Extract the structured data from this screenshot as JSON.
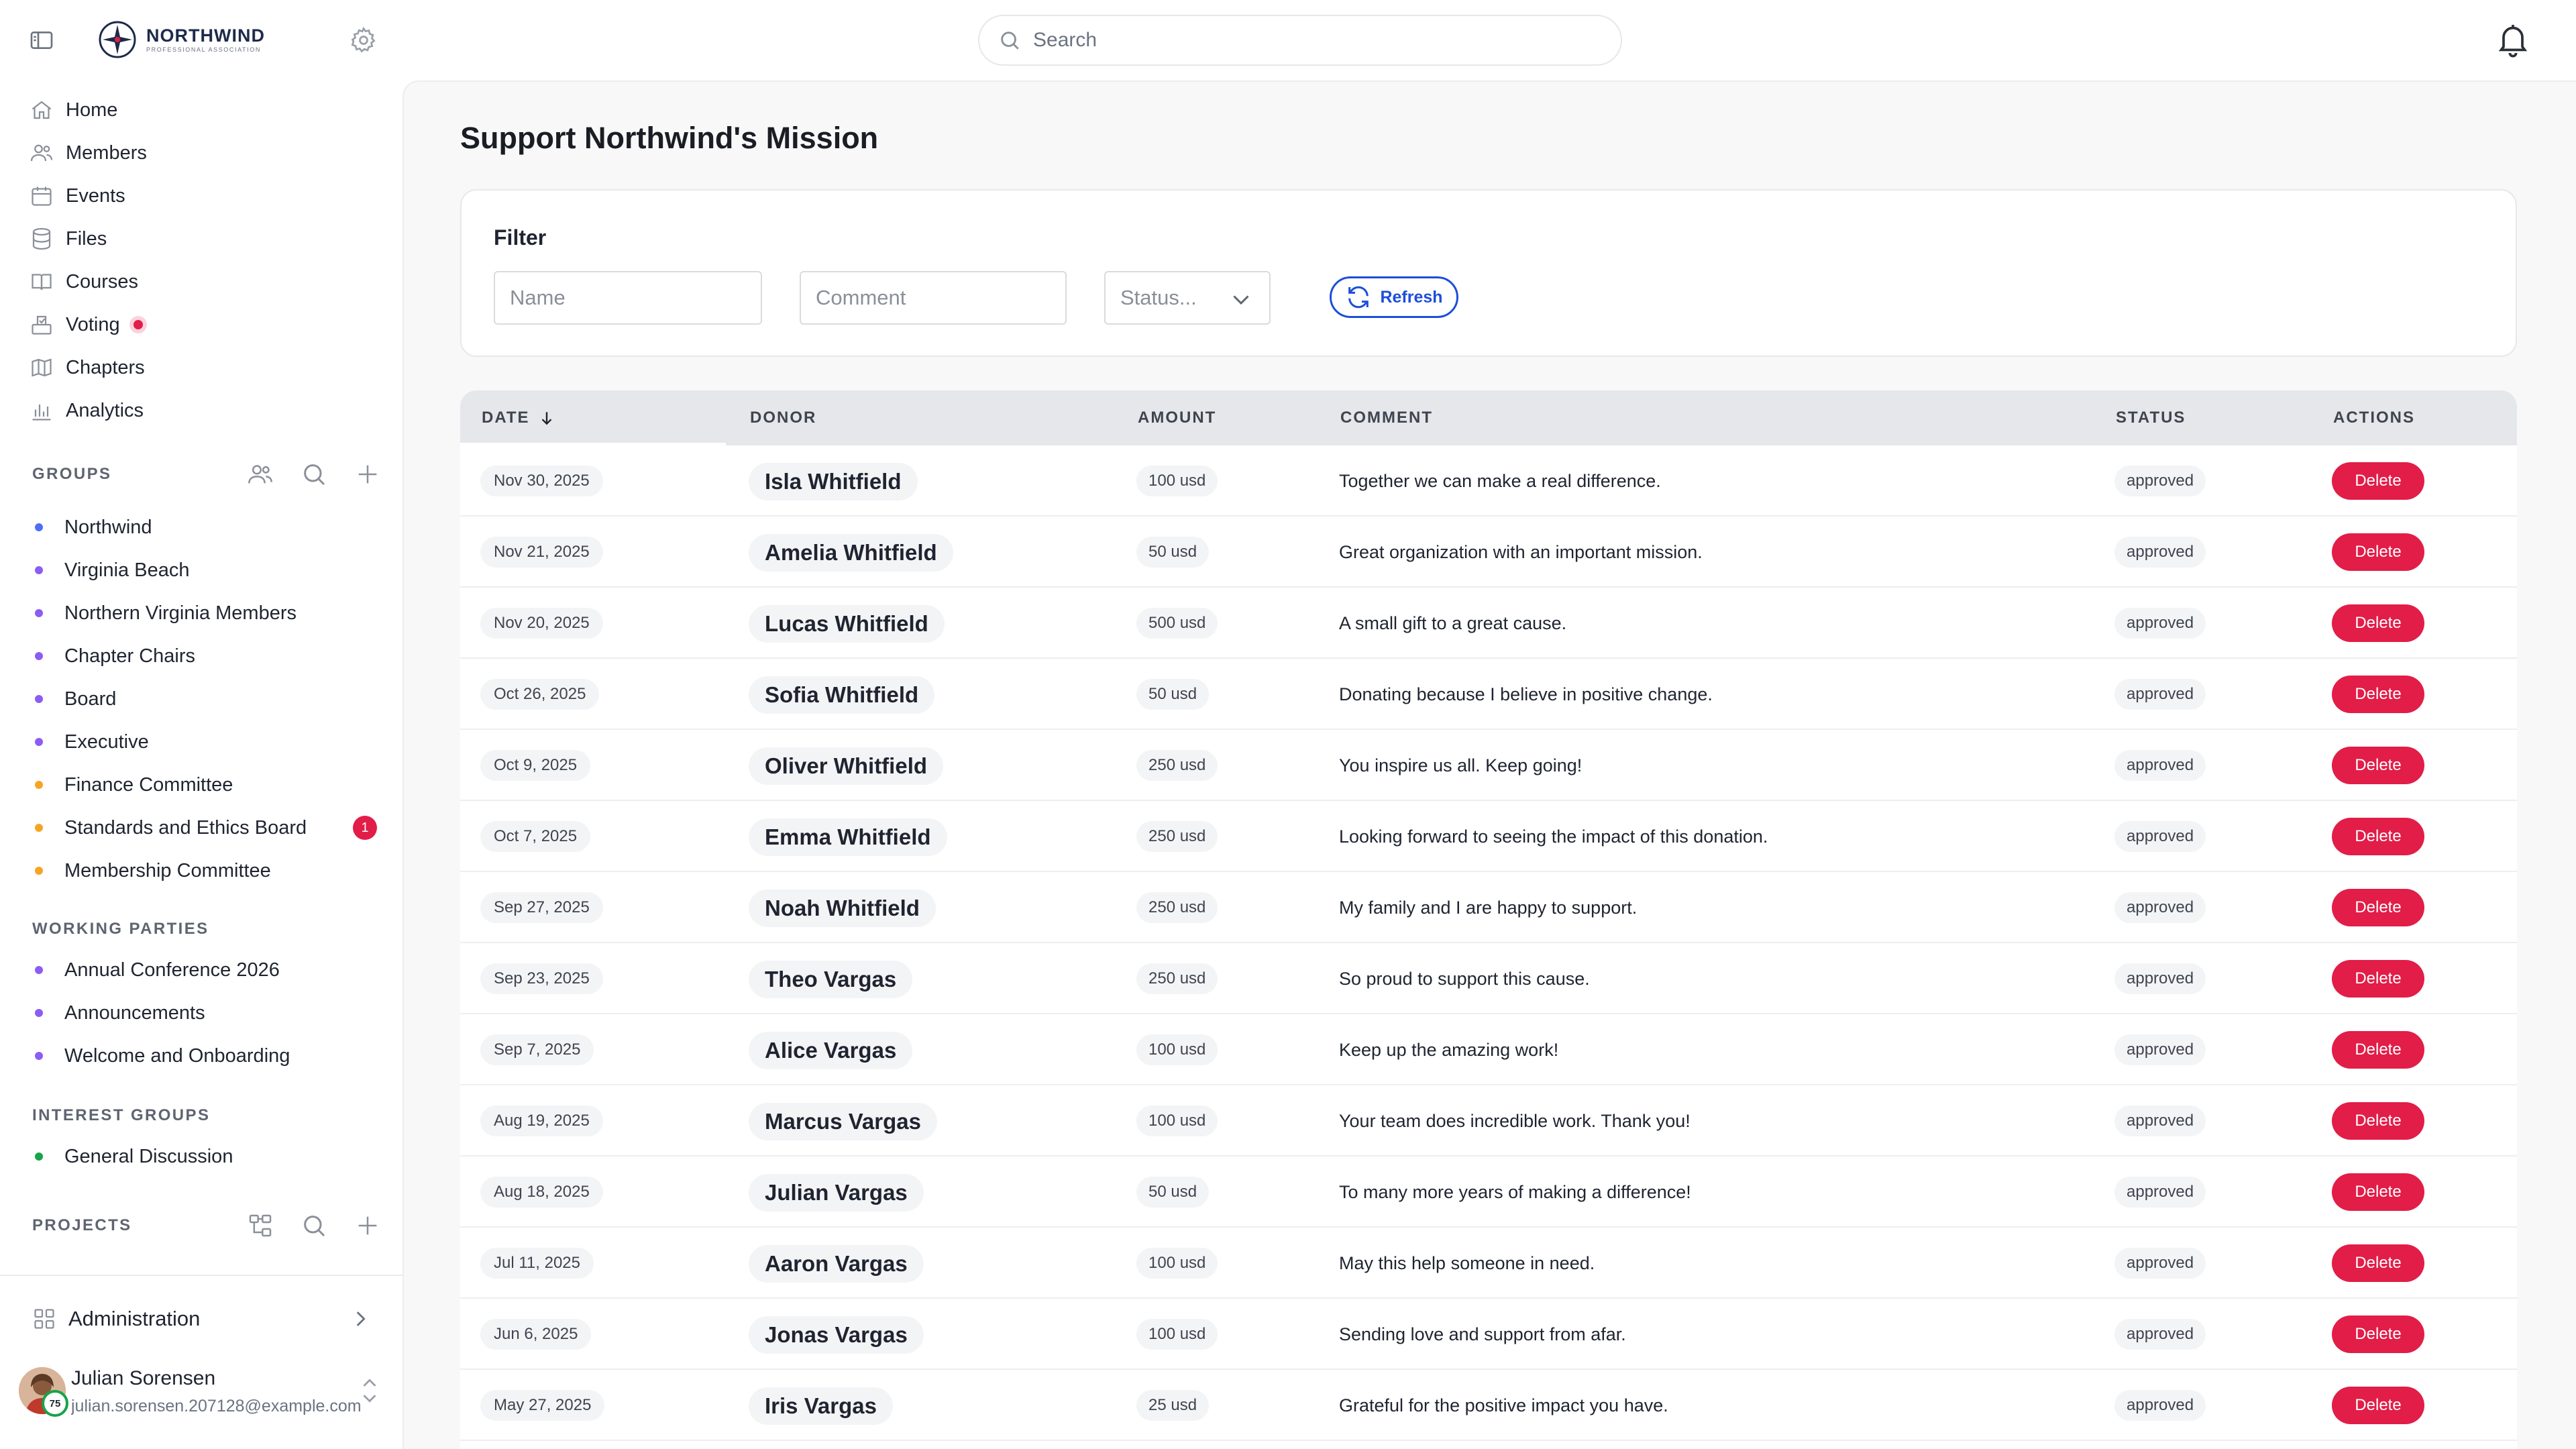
{
  "brand": {
    "name": "NORTHWIND",
    "subtitle": "PROFESSIONAL ASSOCIATION"
  },
  "search": {
    "placeholder": "Search"
  },
  "nav": {
    "items": [
      {
        "label": "Home",
        "icon": "home-icon"
      },
      {
        "label": "Members",
        "icon": "users-icon"
      },
      {
        "label": "Events",
        "icon": "calendar-icon"
      },
      {
        "label": "Files",
        "icon": "database-icon"
      },
      {
        "label": "Courses",
        "icon": "book-icon"
      },
      {
        "label": "Voting",
        "icon": "ballot-icon"
      },
      {
        "label": "Chapters",
        "icon": "map-icon"
      },
      {
        "label": "Analytics",
        "icon": "chart-icon"
      }
    ]
  },
  "groups": {
    "title": "GROUPS",
    "items": [
      {
        "label": "Northwind",
        "color": "#4f6ef7"
      },
      {
        "label": "Virginia Beach",
        "color": "#8b5cf6"
      },
      {
        "label": "Northern Virginia Members",
        "color": "#8b5cf6"
      },
      {
        "label": "Chapter Chairs",
        "color": "#8b5cf6"
      },
      {
        "label": "Board",
        "color": "#8b5cf6"
      },
      {
        "label": "Executive",
        "color": "#8b5cf6"
      },
      {
        "label": "Finance Committee",
        "color": "#f5a524"
      },
      {
        "label": "Standards and Ethics Board",
        "color": "#f5a524",
        "badge": "1"
      },
      {
        "label": "Membership Committee",
        "color": "#f5a524"
      }
    ]
  },
  "working_parties": {
    "title": "WORKING PARTIES",
    "items": [
      {
        "label": "Annual Conference 2026",
        "color": "#8b5cf6"
      },
      {
        "label": "Announcements",
        "color": "#8b5cf6"
      },
      {
        "label": "Welcome and Onboarding",
        "color": "#8b5cf6"
      }
    ]
  },
  "interest_groups": {
    "title": "INTEREST GROUPS",
    "items": [
      {
        "label": "General Discussion",
        "color": "#16a34a"
      }
    ]
  },
  "projects": {
    "title": "PROJECTS"
  },
  "footer": {
    "admin_label": "Administration",
    "user_name": "Julian Sorensen",
    "user_email": "julian.sorensen.207128@example.com",
    "avatar_badge": "75"
  },
  "page": {
    "title": "Support Northwind's Mission"
  },
  "filter": {
    "title": "Filter",
    "name_placeholder": "Name",
    "comment_placeholder": "Comment",
    "status_placeholder": "Status...",
    "refresh_label": "Refresh"
  },
  "table": {
    "headers": {
      "date": "DATE",
      "donor": "DONOR",
      "amount": "AMOUNT",
      "comment": "COMMENT",
      "status": "STATUS",
      "actions": "ACTIONS"
    },
    "delete_label": "Delete",
    "rows": [
      {
        "date": "Nov 30, 2025",
        "donor": "Isla Whitfield",
        "amount": "100 usd",
        "comment": "Together we can make a real difference.",
        "status": "approved"
      },
      {
        "date": "Nov 21, 2025",
        "donor": "Amelia Whitfield",
        "amount": "50 usd",
        "comment": "Great organization with an important mission.",
        "status": "approved"
      },
      {
        "date": "Nov 20, 2025",
        "donor": "Lucas Whitfield",
        "amount": "500 usd",
        "comment": "A small gift to a great cause.",
        "status": "approved"
      },
      {
        "date": "Oct 26, 2025",
        "donor": "Sofia Whitfield",
        "amount": "50 usd",
        "comment": "Donating because I believe in positive change.",
        "status": "approved"
      },
      {
        "date": "Oct 9, 2025",
        "donor": "Oliver Whitfield",
        "amount": "250 usd",
        "comment": "You inspire us all. Keep going!",
        "status": "approved"
      },
      {
        "date": "Oct 7, 2025",
        "donor": "Emma Whitfield",
        "amount": "250 usd",
        "comment": "Looking forward to seeing the impact of this donation.",
        "status": "approved"
      },
      {
        "date": "Sep 27, 2025",
        "donor": "Noah Whitfield",
        "amount": "250 usd",
        "comment": "My family and I are happy to support.",
        "status": "approved"
      },
      {
        "date": "Sep 23, 2025",
        "donor": "Theo Vargas",
        "amount": "250 usd",
        "comment": "So proud to support this cause.",
        "status": "approved"
      },
      {
        "date": "Sep 7, 2025",
        "donor": "Alice Vargas",
        "amount": "100 usd",
        "comment": "Keep up the amazing work!",
        "status": "approved"
      },
      {
        "date": "Aug 19, 2025",
        "donor": "Marcus Vargas",
        "amount": "100 usd",
        "comment": "Your team does incredible work. Thank you!",
        "status": "approved"
      },
      {
        "date": "Aug 18, 2025",
        "donor": "Julian Vargas",
        "amount": "50 usd",
        "comment": "To many more years of making a difference!",
        "status": "approved"
      },
      {
        "date": "Jul 11, 2025",
        "donor": "Aaron Vargas",
        "amount": "100 usd",
        "comment": "May this help someone in need.",
        "status": "approved"
      },
      {
        "date": "Jun 6, 2025",
        "donor": "Jonas Vargas",
        "amount": "100 usd",
        "comment": "Sending love and support from afar.",
        "status": "approved"
      },
      {
        "date": "May 27, 2025",
        "donor": "Iris Vargas",
        "amount": "25 usd",
        "comment": "Grateful for the positive impact you have.",
        "status": "approved"
      }
    ]
  }
}
